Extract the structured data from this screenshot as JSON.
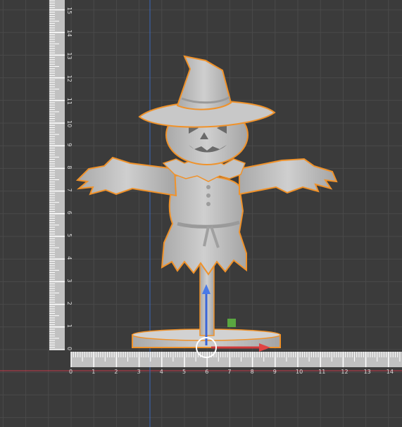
{
  "viewport": {
    "background": "#3b3b3b",
    "grid_color": "#4a4a4a",
    "axis_x_color": "#c23a4a",
    "axis_y_color": "#3a66b8",
    "selection_color": "#f0922a",
    "model_color": "#bdbdbd"
  },
  "vertical_ruler": {
    "labels": [
      "0",
      "1",
      "2",
      "3",
      "4",
      "5",
      "6",
      "7",
      "8",
      "9",
      "10",
      "11",
      "12",
      "13",
      "14",
      "15"
    ]
  },
  "horizontal_ruler": {
    "labels": [
      "0",
      "1",
      "2",
      "3",
      "4",
      "5",
      "6",
      "7",
      "8",
      "9",
      "10",
      "11",
      "12",
      "13",
      "14"
    ]
  },
  "gizmo": {
    "z_arrow": "blue-arrow-icon",
    "x_arrow": "red-arrow-icon",
    "plane_handle": "green-square-icon",
    "rotate_ring": "white-ring-icon"
  },
  "model": {
    "name_icon": "scarecrow-model"
  }
}
